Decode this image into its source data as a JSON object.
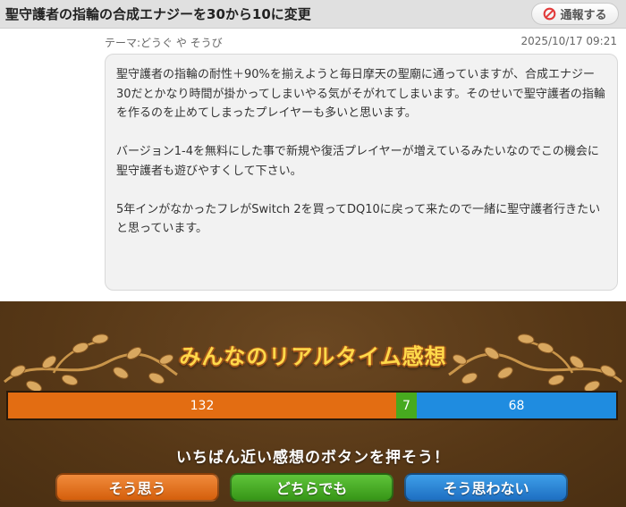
{
  "post": {
    "title": "聖守護者の指輪の合成エナジーを30から10に変更",
    "report_label": "通報する",
    "theme_label": "テーマ:どうぐ や そうび",
    "timestamp": "2025/10/17 09:21",
    "paragraphs": [
      "聖守護者の指輪の耐性＋90%を揃えようと毎日摩天の聖廟に通っていますが、合成エナジー30だとかなり時間が掛かってしまいやる気がそがれてしまいます。そのせいで聖守護者の指輪を作るのを止めてしまったプレイヤーも多いと思います。",
      "バージョン1-4を無料にした事で新規や復活プレイヤーが増えているみたいなのでこの機会に聖守護者も遊びやすくして下さい。",
      "5年インがなかったフレがSwitch 2を買ってDQ10に戻って来たので一緒に聖守護者行きたいと思っています。"
    ]
  },
  "poll": {
    "heading": "みんなのリアルタイム感想",
    "results": {
      "agree": 132,
      "neutral": 7,
      "disagree": 68
    },
    "result_labels": {
      "agree": "132",
      "neutral": "7",
      "disagree": "68"
    },
    "prompt": "いちばん近い感想のボタンを押そう！",
    "buttons": {
      "agree": "そう思う",
      "neutral": "どちらでも",
      "disagree": "そう思わない"
    },
    "colors": {
      "agree": "#e36d12",
      "neutral": "#47aa1f",
      "disagree": "#1f8ce0",
      "heading": "#ffd94a",
      "panel": "#5a3b1a"
    }
  },
  "icons": {
    "report": "prohibited-icon",
    "decor": "vine-leaves-icon"
  }
}
